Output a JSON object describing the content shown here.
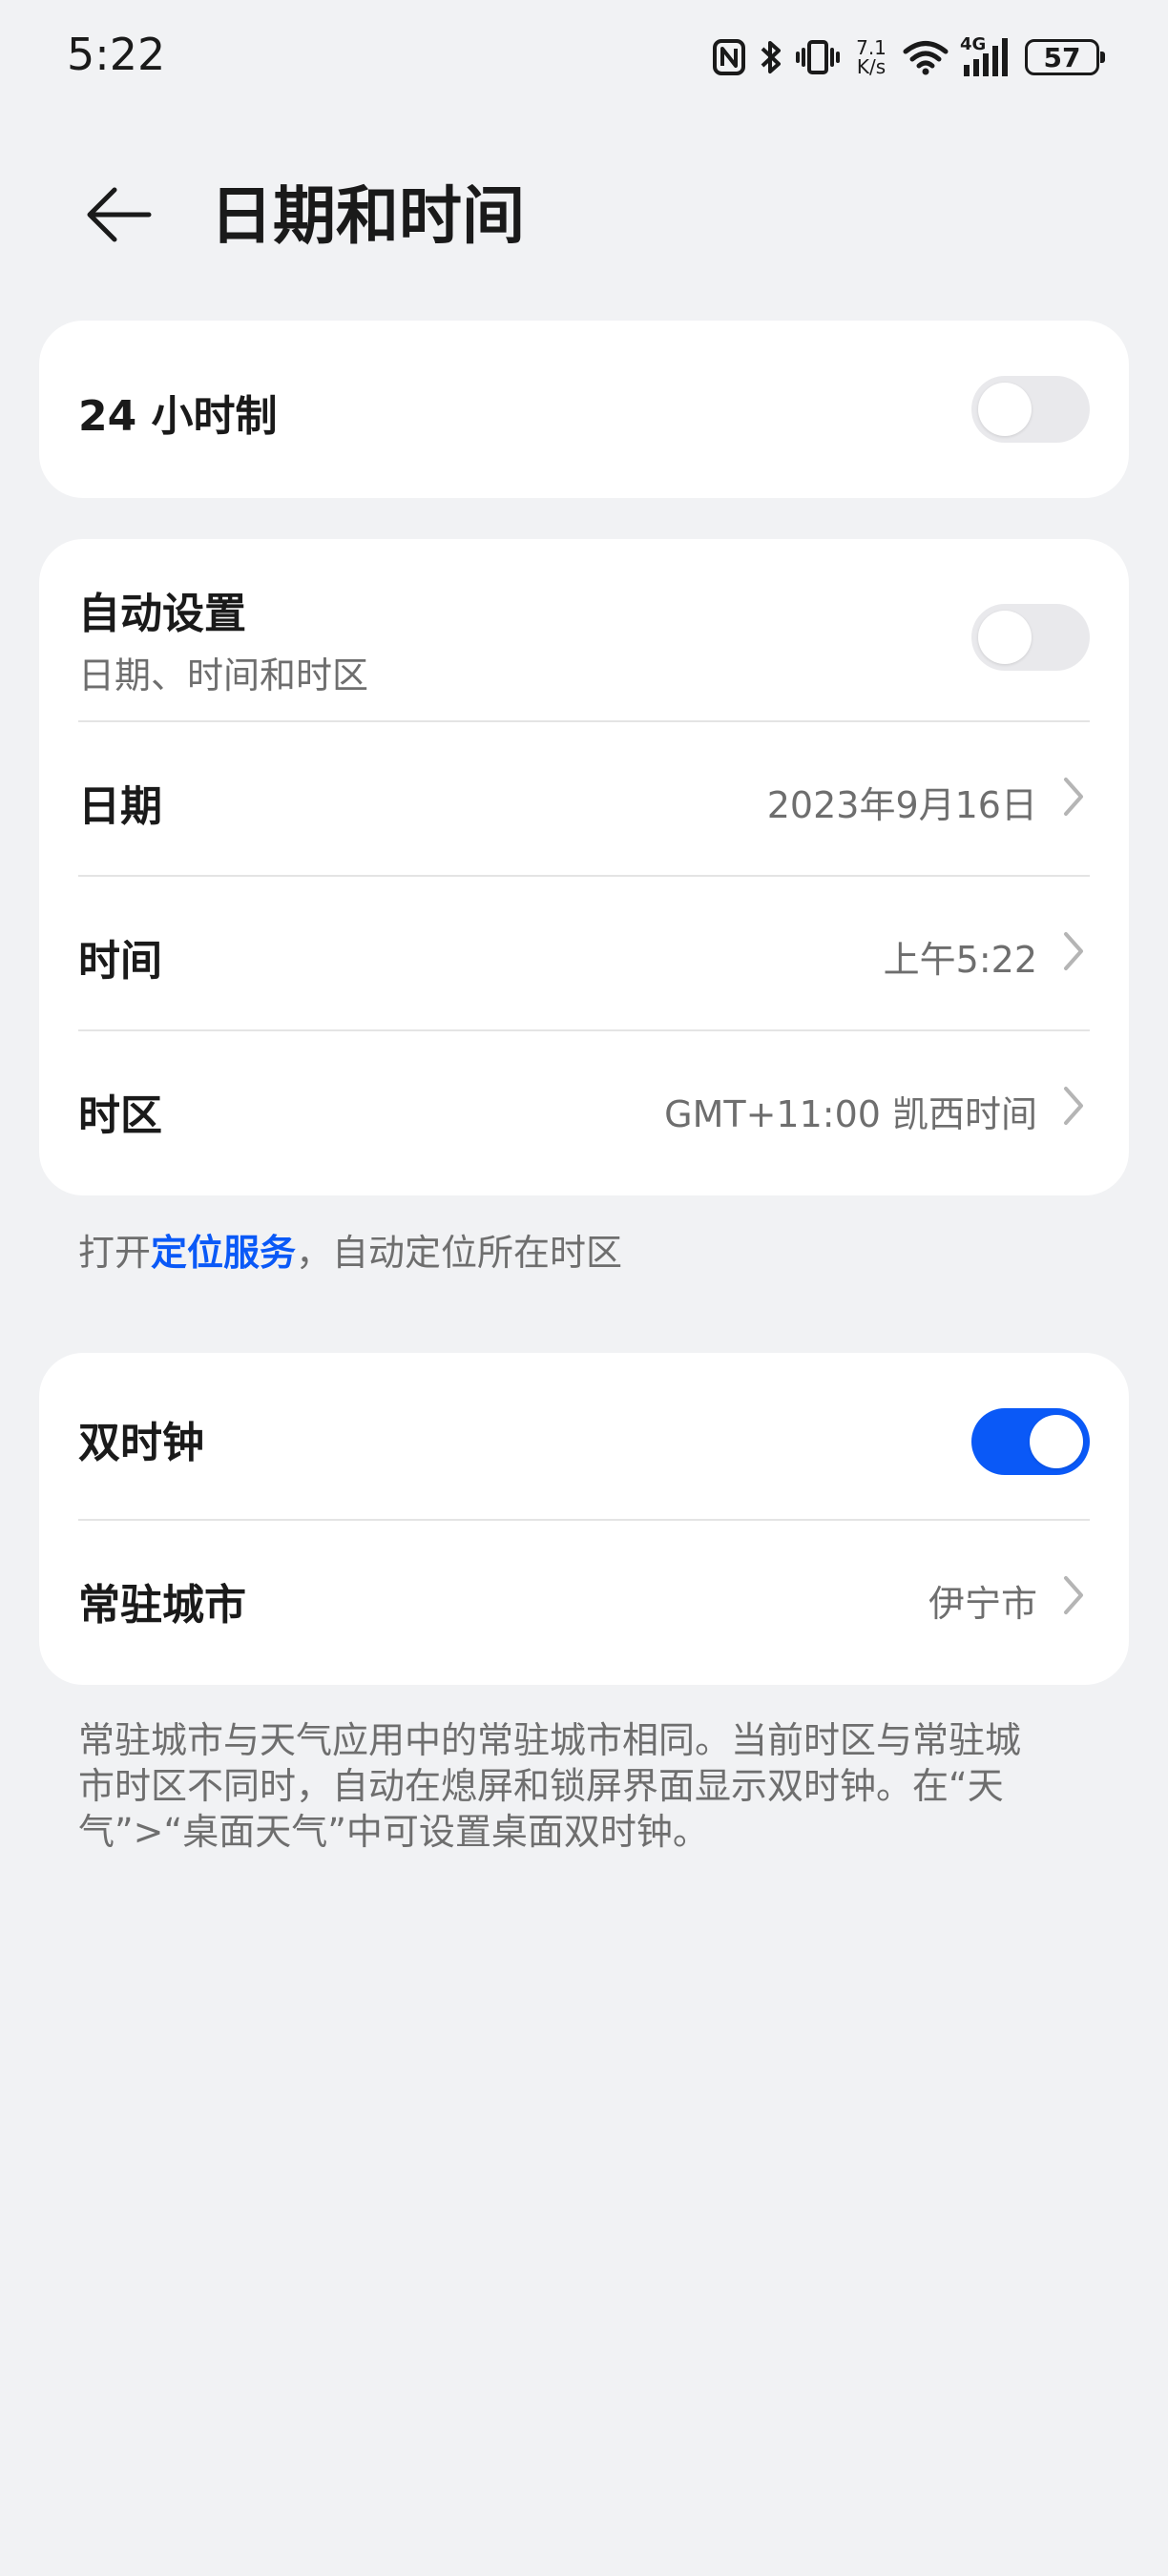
{
  "status_bar": {
    "time": "5:22",
    "net_speed_value": "7.1",
    "net_speed_unit": "K/s",
    "network": "4G",
    "battery": "57",
    "icons": [
      "nfc-icon",
      "bluetooth-icon",
      "vibrate-icon",
      "wifi-icon",
      "signal-icon",
      "battery-icon"
    ]
  },
  "header": {
    "title": "日期和时间",
    "back_icon": "arrow-left-icon"
  },
  "card_24h": {
    "label": "24 小时制",
    "enabled": false
  },
  "card_datetime": {
    "auto": {
      "label": "自动设置",
      "sub": "日期、时间和时区",
      "enabled": false
    },
    "date": {
      "label": "日期",
      "value": "2023年9月16日"
    },
    "time": {
      "label": "时间",
      "value": "上午5:22"
    },
    "timezone": {
      "label": "时区",
      "value": "GMT+11:00 凯西时间"
    }
  },
  "hint": {
    "prefix": "打开",
    "link": "定位服务",
    "suffix": "，自动定位所在时区"
  },
  "card_dual": {
    "dual_clock": {
      "label": "双时钟",
      "enabled": true
    },
    "home_city": {
      "label": "常驻城市",
      "value": "伊宁市"
    }
  },
  "note": "常驻城市与天气应用中的常驻城市相同。当前时区与常驻城市时区不同时，自动在熄屏和锁屏界面显示双时钟。在“天气”>“桌面天气”中可设置桌面双时钟。",
  "colors": {
    "background": "#f1f2f4",
    "card": "#ffffff",
    "accent": "#0a59f7",
    "toggle_off": "#e9e9ec",
    "secondary_text": "#6e6e6e"
  }
}
